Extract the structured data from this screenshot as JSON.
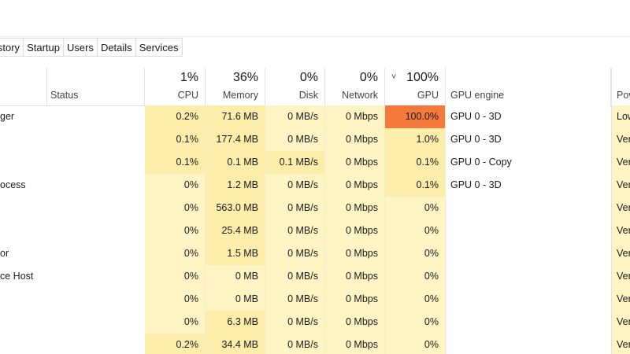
{
  "tabs": [
    "istory",
    "Startup",
    "Users",
    "Details",
    "Services"
  ],
  "headers": {
    "status": "Status",
    "cpu": {
      "pct": "1%",
      "label": "CPU"
    },
    "memory": {
      "pct": "36%",
      "label": "Memory"
    },
    "disk": {
      "pct": "0%",
      "label": "Disk"
    },
    "network": {
      "pct": "0%",
      "label": "Network"
    },
    "gpu": {
      "pct": "100%",
      "label": "GPU",
      "sort_glyph": "˅"
    },
    "gpu_engine": "GPU engine",
    "power": "Pov"
  },
  "rows": [
    {
      "name": "ger",
      "leaf": false,
      "cpu": "0.2%",
      "memory": "71.6 MB",
      "disk": "0 MB/s",
      "network": "0 Mbps",
      "gpu": "100.0%",
      "engine": "GPU 0 - 3D",
      "power": "Low"
    },
    {
      "name": "",
      "leaf": false,
      "cpu": "0.1%",
      "memory": "177.4 MB",
      "disk": "0 MB/s",
      "network": "0 Mbps",
      "gpu": "1.0%",
      "engine": "GPU 0 - 3D",
      "power": "Very"
    },
    {
      "name": "",
      "leaf": false,
      "cpu": "0.1%",
      "memory": "0.1 MB",
      "disk": "0.1 MB/s",
      "network": "0 Mbps",
      "gpu": "0.1%",
      "engine": "GPU 0 - Copy",
      "power": "Very"
    },
    {
      "name": "ocess",
      "leaf": false,
      "cpu": "0%",
      "memory": "1.2 MB",
      "disk": "0 MB/s",
      "network": "0 Mbps",
      "gpu": "0.1%",
      "engine": "GPU 0 - 3D",
      "power": "Very"
    },
    {
      "name": "",
      "leaf": false,
      "cpu": "0%",
      "memory": "563.0 MB",
      "disk": "0 MB/s",
      "network": "0 Mbps",
      "gpu": "0%",
      "engine": "",
      "power": "Very"
    },
    {
      "name": "",
      "leaf": false,
      "cpu": "0%",
      "memory": "25.4 MB",
      "disk": "0 MB/s",
      "network": "0 Mbps",
      "gpu": "0%",
      "engine": "",
      "power": "Very"
    },
    {
      "name": "or",
      "leaf": false,
      "cpu": "0%",
      "memory": "1.5 MB",
      "disk": "0 MB/s",
      "network": "0 Mbps",
      "gpu": "0%",
      "engine": "",
      "power": "Very"
    },
    {
      "name": "ce Host",
      "leaf": true,
      "cpu": "0%",
      "memory": "0 MB",
      "disk": "0 MB/s",
      "network": "0 Mbps",
      "gpu": "0%",
      "engine": "",
      "power": "Very"
    },
    {
      "name": "",
      "leaf": true,
      "cpu": "0%",
      "memory": "0 MB",
      "disk": "0 MB/s",
      "network": "0 Mbps",
      "gpu": "0%",
      "engine": "",
      "power": "Very"
    },
    {
      "name": "",
      "leaf": false,
      "cpu": "0%",
      "memory": "6.3 MB",
      "disk": "0 MB/s",
      "network": "0 Mbps",
      "gpu": "0%",
      "engine": "",
      "power": "Very"
    },
    {
      "name": "",
      "leaf": false,
      "cpu": "0.2%",
      "memory": "34.4 MB",
      "disk": "0 MB/s",
      "network": "0 Mbps",
      "gpu": "0%",
      "engine": "",
      "power": "Very"
    }
  ],
  "colors": {
    "heat_light": "#fff4c4",
    "heat_mid": "#fdedaa",
    "heat_strong": "#f9e289",
    "heat_critical": "#f5793a",
    "leaf_icon": "#2e8b3e"
  }
}
